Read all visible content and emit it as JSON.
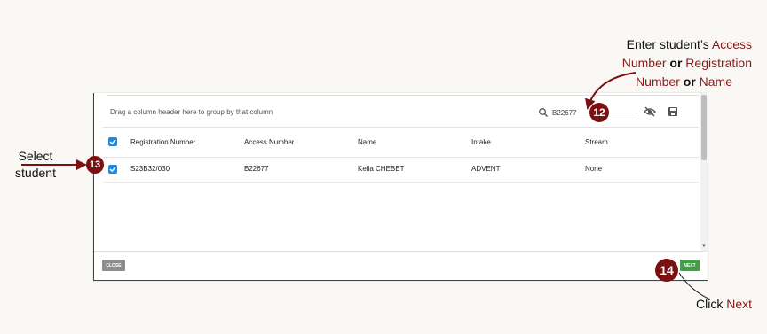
{
  "grid": {
    "group_hint": "Drag a column header here to group by that column",
    "search_value": "B22677",
    "columns": [
      "Registration Number",
      "Access Number",
      "Name",
      "Intake",
      "Stream"
    ],
    "rows": [
      {
        "registration_number": "S23B32/030",
        "access_number": "B22677",
        "name": "Keila CHEBET",
        "intake": "ADVENT",
        "stream": "None"
      }
    ]
  },
  "buttons": {
    "close": "CLOSE",
    "next": "NEXT"
  },
  "steps": {
    "search": "12",
    "select": "13",
    "next": "14"
  },
  "annotations": {
    "search": {
      "line1": "Enter student’s ",
      "access": "Access",
      "number1": "Number",
      "or1": "or",
      "registration": "Registration",
      "number2": "Number",
      "or2": "or",
      "name": "Name"
    },
    "select": {
      "line1": "Select",
      "line2": "student"
    },
    "next": {
      "click": "Click ",
      "next": "Next"
    }
  },
  "icons": [
    "search-icon",
    "hide-columns-icon",
    "save-icon",
    "checkbox-checked-icon"
  ],
  "colors": {
    "accent": "#8b1a1a",
    "badge": "#7a1010",
    "checkbox": "#1e88e5",
    "next_button": "#43a047",
    "close_button": "#8e8e8e"
  }
}
